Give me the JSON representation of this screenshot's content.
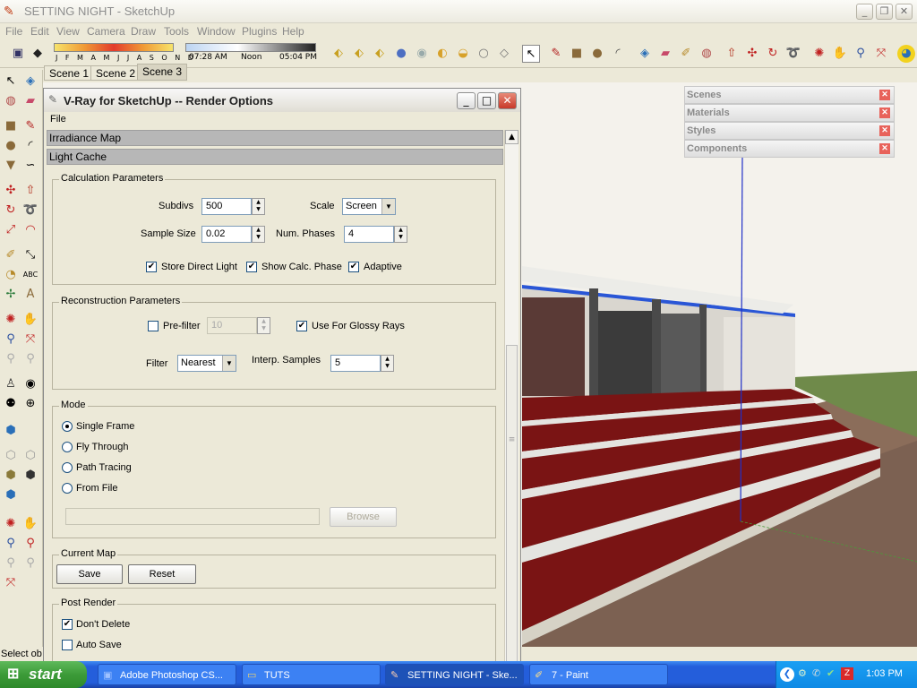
{
  "window": {
    "title": "SETTING NIGHT - SketchUp",
    "minimize": "_",
    "maximize": "❐",
    "close": "✕"
  },
  "menu": [
    "File",
    "Edit",
    "View",
    "Camera",
    "Draw",
    "Tools",
    "Window",
    "Plugins",
    "Help"
  ],
  "shadow": {
    "months": "J F M A M J J A S O N D",
    "time_start": "07:28 AM",
    "time_mid": "Noon",
    "time_end": "05:04 PM"
  },
  "scenes": [
    "Scene 1",
    "Scene 2",
    "Scene 3"
  ],
  "status": "Select ob",
  "vray": {
    "title": "V-Ray for SketchUp -- Render Options",
    "menu_file": "File",
    "rollouts": [
      "Irradiance Map",
      "Light Cache"
    ],
    "calc": {
      "group": "Calculation Parameters",
      "subdivs_label": "Subdivs",
      "subdivs": "500",
      "scale_label": "Scale",
      "scale": "Screen",
      "sample_label": "Sample Size",
      "sample": "0.02",
      "phases_label": "Num. Phases",
      "phases": "4",
      "store_direct": "Store Direct Light",
      "show_calc": "Show Calc. Phase",
      "adaptive": "Adaptive"
    },
    "recon": {
      "group": "Reconstruction Parameters",
      "prefilter": "Pre-filter",
      "prefilter_value": "10",
      "glossy": "Use For Glossy Rays",
      "filter_label": "Filter",
      "filter": "Nearest",
      "interp_label": "Interp. Samples",
      "interp": "5"
    },
    "mode": {
      "group": "Mode",
      "options": [
        "Single Frame",
        "Fly Through",
        "Path Tracing",
        "From File"
      ],
      "browse": "Browse"
    },
    "current_map": {
      "group": "Current Map",
      "save": "Save",
      "reset": "Reset"
    },
    "post": {
      "group": "Post Render",
      "dont_delete": "Don't Delete",
      "auto_save": "Auto Save"
    }
  },
  "trays": [
    "Scenes",
    "Materials",
    "Styles",
    "Components"
  ],
  "taskbar": {
    "start": "start",
    "items": [
      "Adobe Photoshop CS...",
      "TUTS",
      "SETTING NIGHT - Ske...",
      "7 - Paint"
    ],
    "clock": "1:03 PM"
  },
  "colors": {
    "taskbar": "#245edb",
    "start": "#3c9b38",
    "roof": "#2a56d6",
    "floor": "#7a1414",
    "grass": "#6f8a4a",
    "sky": "#f4f2ec"
  }
}
